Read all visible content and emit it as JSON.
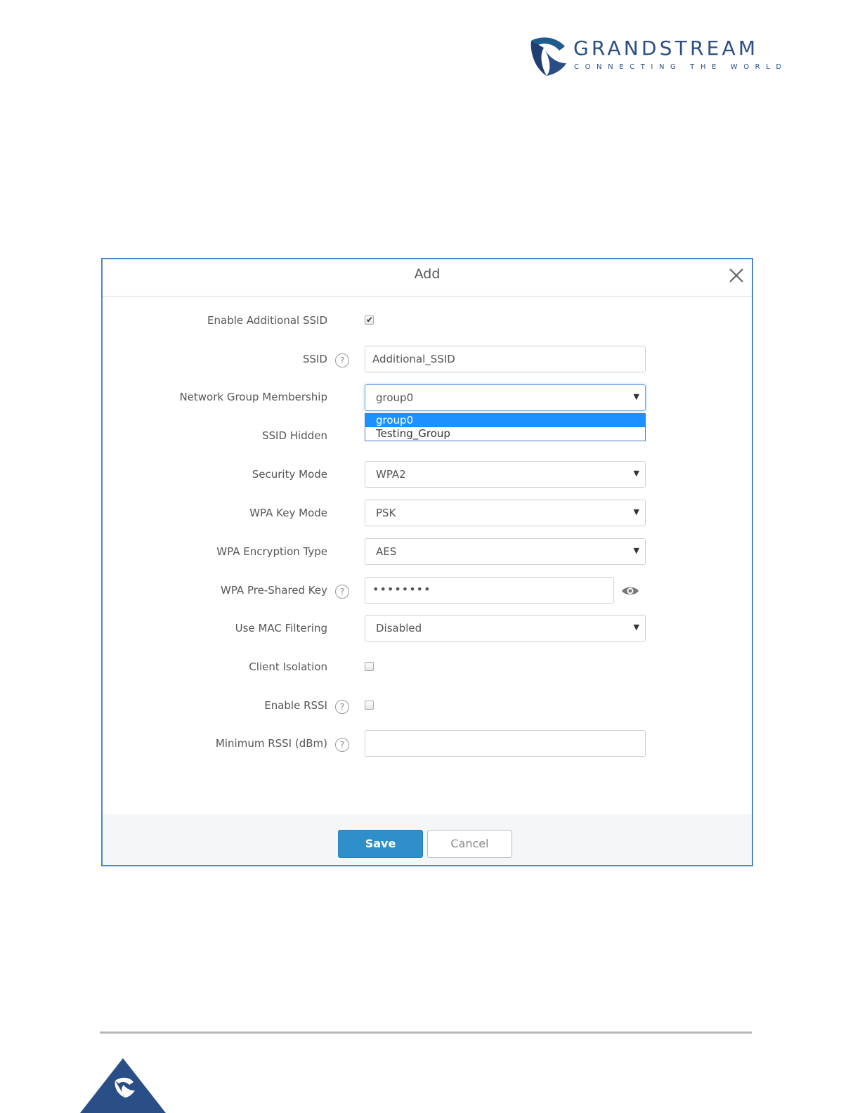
{
  "logo": {
    "brand": "GRANDSTREAM",
    "tagline": "CONNECTING THE WORLD"
  },
  "dialog": {
    "title": "Add",
    "fields": {
      "enable_additional_ssid": {
        "label": "Enable Additional SSID",
        "checked": true
      },
      "ssid": {
        "label": "SSID",
        "value": "Additional_SSID"
      },
      "network_group": {
        "label": "Network Group Membership",
        "value": "group0",
        "options": [
          "group0",
          "Testing_Group"
        ]
      },
      "ssid_hidden": {
        "label": "SSID Hidden"
      },
      "security_mode": {
        "label": "Security Mode",
        "value": "WPA2"
      },
      "wpa_key_mode": {
        "label": "WPA Key Mode",
        "value": "PSK"
      },
      "wpa_encryption_type": {
        "label": "WPA Encryption Type",
        "value": "AES"
      },
      "wpa_psk": {
        "label": "WPA Pre-Shared Key",
        "value": "••••••••"
      },
      "mac_filtering": {
        "label": "Use MAC Filtering",
        "value": "Disabled"
      },
      "client_isolation": {
        "label": "Client Isolation",
        "checked": false
      },
      "enable_rssi": {
        "label": "Enable RSSI",
        "checked": false
      },
      "minimum_rssi": {
        "label": "Minimum RSSI (dBm)",
        "value": ""
      }
    },
    "help_glyph": "?",
    "buttons": {
      "save": "Save",
      "cancel": "Cancel"
    }
  },
  "colors": {
    "brand_blue": "#2a4f86",
    "dialog_border": "#4f86c6",
    "save_button": "#2e8fcb",
    "dropdown_highlight": "#1e90ff"
  }
}
